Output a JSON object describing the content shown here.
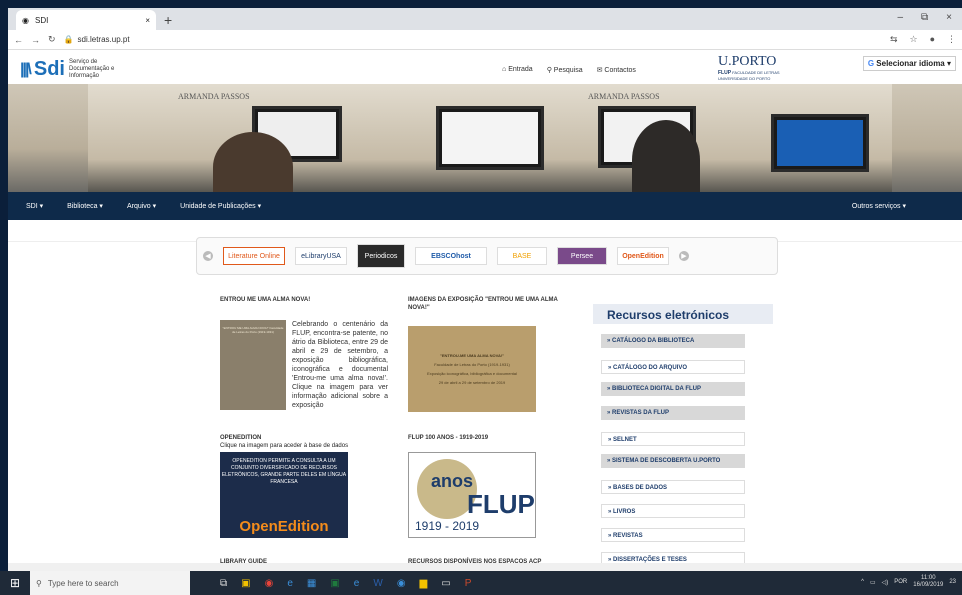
{
  "browser": {
    "tab_title": "SDI",
    "tab_close": "×",
    "new_tab": "+",
    "url": "sdi.letras.up.pt",
    "window_controls": [
      "–",
      "⧉",
      "×"
    ]
  },
  "site": {
    "logo_sdi": "Sdi",
    "logo_name": "Serviço de Documentação e Informação",
    "topnav": [
      "Entrada",
      "Pesquisa",
      "Contactos"
    ],
    "porto_logo": "U.PORTO",
    "porto_sub": "FACULDADE DE LETRAS UNIVERSIDADE DO PORTO",
    "flup_tag": "FLUP",
    "language": "Selecionar idioma"
  },
  "hero": {
    "caption_left": "ARMANDA PASSOS",
    "caption_right": "ARMANDA PASSOS"
  },
  "mainnav": {
    "items": [
      "SDI ▾",
      "Biblioteca ▾",
      "Arquivo ▾",
      "Unidade de Publicações ▾"
    ],
    "other": "Outros serviços ▾"
  },
  "carousel": {
    "logos": [
      "Literature Online",
      "eLibraryUSA",
      "Periodicos",
      "EBSCOhost",
      "BASE",
      "Persee",
      "OpenEdition"
    ]
  },
  "content": {
    "col1_heading": "ENTROU ME UMA ALMA NOVA!",
    "col1_para": "Celebrando o centenário da FLUP, encontra-se patente, no átrio da Biblioteca, entre 29 de abril e 29 de setembro, a exposição bibliográfica, iconográfica e documental 'Entrou-me uma alma nova!'. Clique na imagem para ver informação adicional sobre a exposição",
    "col1_book": "\"ENTROU ME UMA ALMA NOVA!\" Faculdade de Letras do Porto (1919-1931)",
    "col2_heading": "IMAGENS DA EXPOSIÇÃO \"ENTROU ME UMA ALMA NOVA!\"",
    "col2_exhib_title": "\"ENTROU-ME UMA ALMA NOVA!\"",
    "col2_exhib_sub": "Faculdade de Letras do Porto (1919-1931)",
    "col2_exhib_desc": "Exposição iconográfica, bibliográfica e documental",
    "col2_exhib_date": "29 de abril a 29 de setembro de 2019",
    "oe_heading": "OPENEDITION",
    "oe_sub": "Clique na imagem para aceder à base de dados",
    "oe_text": "OPENEDITION PERMITE A CONSULTA A UM CONJUNTO DIVERSIFICADO DE RECURSOS ELETRÓNICOS, GRANDE PARTE DELES EM LÍNGUA FRANCESA",
    "oe_logo": "OpenEdition",
    "flup_heading": "FLUP 100 ANOS - 1919-2019",
    "flup_anos": "anos",
    "flup_name": "FLUP",
    "flup_years": "1919 - 2019",
    "lib_guide": "LIBRARY GUIDE",
    "recursos_acp": "RECURSOS DISPONÍVEIS NOS ESPAÇOS ACP"
  },
  "sidebar": {
    "title": "Recursos eletrónicos",
    "items": [
      "» CATÁLOGO DA BIBLIOTECA",
      "» CATÁLOGO DO ARQUIVO",
      "» BIBLIOTECA DIGITAL DA FLUP",
      "» REVISTAS DA FLUP",
      "» SELNET",
      "» SISTEMA DE DESCOBERTA U.PORTO",
      "» BASES DE DADOS",
      "» LIVROS",
      "» REVISTAS",
      "» DISSERTAÇÕES E TESES"
    ]
  },
  "taskbar": {
    "search_placeholder": "Type here to search",
    "lang": "POR",
    "time": "11:00",
    "date": "16/09/2019",
    "notif": "23"
  }
}
